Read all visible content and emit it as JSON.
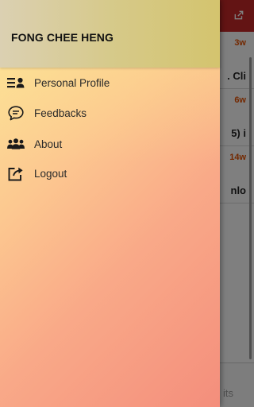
{
  "drawer": {
    "user_name": "FONG CHEE HENG",
    "menu": [
      {
        "label": "Personal Profile",
        "icon": "profile-list-icon"
      },
      {
        "label": "Feedbacks",
        "icon": "chat-bubble-icon"
      },
      {
        "label": "About",
        "icon": "group-icon"
      },
      {
        "label": "Logout",
        "icon": "share-out-icon"
      }
    ]
  },
  "background": {
    "rows": [
      {
        "title_fragment": ". Cli",
        "time": "3w"
      },
      {
        "title_fragment": "",
        "time": "6w"
      },
      {
        "title_fragment": "5) i",
        "time": "14w"
      },
      {
        "title_fragment": "nlo",
        "time": ""
      }
    ],
    "bottom_label": "its"
  },
  "colors": {
    "app_bar": "#c62828",
    "time_accent": "#e65100"
  }
}
